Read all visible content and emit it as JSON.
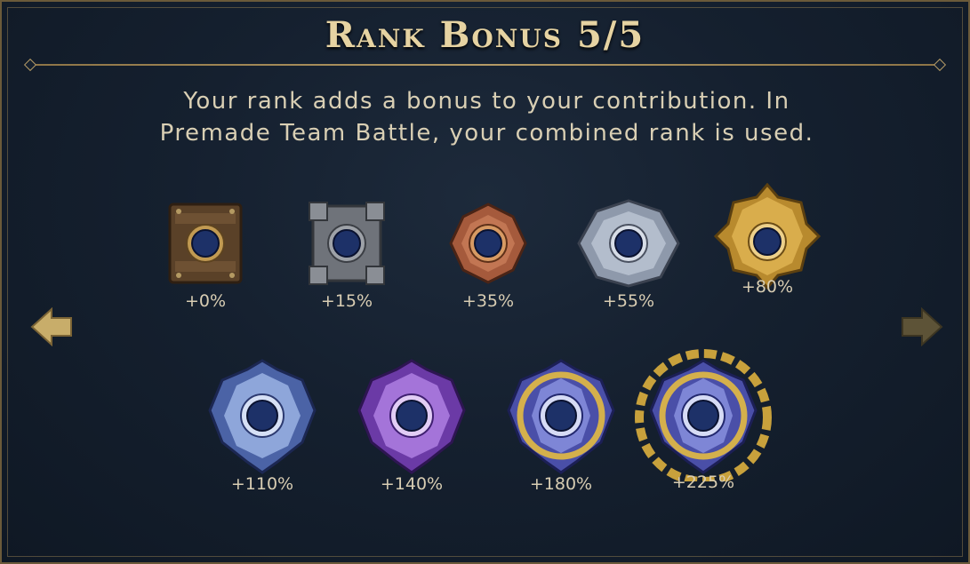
{
  "title": "Rank Bonus 5/5",
  "description_line1": "Your rank adds a bonus to your contribution. In",
  "description_line2": "Premade Team Battle, your combined rank is used.",
  "ranks": [
    {
      "tier": "wood",
      "bonus": "+0%"
    },
    {
      "tier": "stone",
      "bonus": "+15%"
    },
    {
      "tier": "bronze",
      "bonus": "+35%"
    },
    {
      "tier": "silver",
      "bonus": "+55%"
    },
    {
      "tier": "gold",
      "bonus": "+80%"
    },
    {
      "tier": "platinum",
      "bonus": "+110%"
    },
    {
      "tier": "amethyst",
      "bonus": "+140%"
    },
    {
      "tier": "master",
      "bonus": "+180%"
    },
    {
      "tier": "grandmaster",
      "bonus": "+225%"
    }
  ],
  "colors": {
    "gold_text": "#e6d3a2",
    "arrow_active": "#c8ad6a",
    "arrow_inactive": "#5d5337"
  },
  "icons": {
    "prev": "left-arrow-icon",
    "next": "right-arrow-icon"
  }
}
